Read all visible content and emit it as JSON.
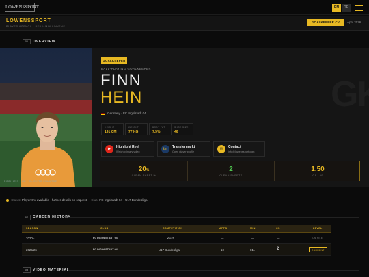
{
  "topbar": {
    "logo_text": "LOWENSSPORT",
    "lang_en": "EN",
    "lang_de": "DE"
  },
  "header": {
    "brand": "LOWENSSPORT",
    "subtitle": "PLAYER AGENCY · BENJAMIN LOWENS",
    "cv_button": "GOALKEEPER CV",
    "date": "April 2026"
  },
  "overview": {
    "num": "01",
    "title": "OVERVIEW",
    "photo_caption": "FINN HEIN · GK · CLICK TO ENLARGE",
    "position_badge": "GOALKEEPER",
    "role": "BALL-PLAYING GOALKEEPER",
    "first_name": "FINN",
    "last_name": "HEIN",
    "background_text": "GK",
    "nationality_club": "Germany · FC Ingolstadt 04",
    "stats": [
      {
        "label": "HEIGHT",
        "value": "191 CM"
      },
      {
        "label": "WEIGHT",
        "value": "77 KG"
      },
      {
        "label": "BODY FAT",
        "value": "7.5%"
      },
      {
        "label": "SHOE SIZE",
        "value": "46"
      }
    ],
    "links": [
      {
        "title": "Highlight Reel",
        "sub": "Watch primary video",
        "icon": "play-icon",
        "color": "#e0261b"
      },
      {
        "title": "Transfermarkt",
        "sub": "Open player profile",
        "icon": "transfermarkt-icon",
        "color": "#1b3a66"
      },
      {
        "title": "Contact",
        "sub": "info@lowenssport.com",
        "icon": "email-icon",
        "color": "#e8b923"
      }
    ],
    "kpis": [
      {
        "value": "20",
        "suffix": "%",
        "label": "CLEAN SHEET %",
        "color": "#e8b923"
      },
      {
        "value": "2",
        "suffix": "",
        "label": "CLEAN SHEETS",
        "color": "#4fc34f"
      },
      {
        "value": "1.50",
        "suffix": "",
        "label": "GA / 90",
        "color": "#e8b923"
      }
    ]
  },
  "status_bar": {
    "status_label": "Status:",
    "status_text": "Player CV available · further details on request",
    "club_label": "Club:",
    "club_text": "FC Ingolstadt 04 · U17 Bundesliga"
  },
  "career": {
    "num": "02",
    "title": "CAREER HISTORY",
    "columns": [
      "SEASON",
      "CLUB",
      "COMPETITION",
      "APPS",
      "MIN",
      "CS",
      "LEVEL"
    ],
    "rows": [
      {
        "season": "2020–",
        "club": "FC INGOLSTADT 04",
        "competition": "Youth",
        "apps": "—",
        "min": "—",
        "cs": "—",
        "level": "ON FILE"
      },
      {
        "season": "2025/26",
        "club": "FC INGOLSTADT 04",
        "competition": "U17 Bundesliga",
        "apps": "10",
        "min": "811",
        "cs": "2",
        "level": "CURRENT"
      }
    ]
  },
  "video": {
    "num": "03",
    "title": "VIDEO MATERIAL"
  }
}
